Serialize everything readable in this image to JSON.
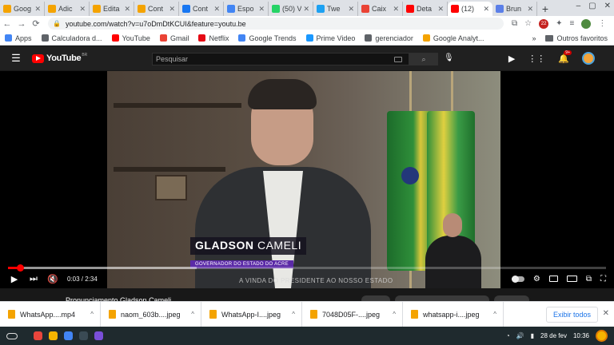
{
  "browser": {
    "tabs": [
      {
        "title": "Goog",
        "color": "#f4a300"
      },
      {
        "title": "Adic",
        "color": "#f4a300"
      },
      {
        "title": "Edita",
        "color": "#f4a300"
      },
      {
        "title": "Cont",
        "color": "#f4a300"
      },
      {
        "title": "Cont",
        "color": "#1877f2"
      },
      {
        "title": "Espo",
        "color": "#4285f4"
      },
      {
        "title": "(50) V",
        "color": "#25d366"
      },
      {
        "title": "Twe",
        "color": "#1da1f2"
      },
      {
        "title": "Caix",
        "color": "#ea4335"
      },
      {
        "title": "Deta",
        "color": "#ff0000"
      },
      {
        "title": "(12)",
        "color": "#ff0000",
        "active": true
      },
      {
        "title": "Brun",
        "color": "#5b7fe8"
      }
    ],
    "new_tab_label": "+",
    "window_controls": [
      "–",
      "▢",
      "✕"
    ],
    "address": "youtube.com/watch?v=u7oDmDtKCUI&feature=youtu.be",
    "ext_badge": "22",
    "bookmarks": [
      {
        "label": "Apps",
        "color": "#4285f4"
      },
      {
        "label": "Calculadora d...",
        "color": "#5f6368"
      },
      {
        "label": "YouTube",
        "color": "#ff0000"
      },
      {
        "label": "Gmail",
        "color": "#ea4335"
      },
      {
        "label": "Netflix",
        "color": "#e50914"
      },
      {
        "label": "Google Trends",
        "color": "#4285f4"
      },
      {
        "label": "Prime Video",
        "color": "#1a98ff"
      },
      {
        "label": "gerenciador",
        "color": "#5f6368"
      },
      {
        "label": "Google Analyt...",
        "color": "#f4a300"
      }
    ],
    "bookmarks_overflow": "»",
    "other_bookmarks": "Outros favoritos"
  },
  "youtube": {
    "logo_text": "YouTube",
    "logo_country": "BR",
    "search_placeholder": "Pesquisar",
    "notif_badge": "9+"
  },
  "player": {
    "lower_third_first": "GLADSON",
    "lower_third_last": "CAMELI",
    "lower_third_role": "GOVERNADOR DO ESTADO DO ACRE",
    "ticker": "A VINDA DO PRESIDENTE AO NOSSO ESTADO",
    "current_time": "0:03",
    "duration": "2:34",
    "time_display": "0:03 / 2:34",
    "played_fraction": 0.0195,
    "buffered_fraction": 0.316
  },
  "video_title": "Pronunciamento Gladson Cameli",
  "downloads": [
    {
      "name": "WhatsApp....mp4",
      "color": "#f4a300"
    },
    {
      "name": "naom_603b....jpeg",
      "color": "#f4a300"
    },
    {
      "name": "WhatsApp-I....jpeg",
      "color": "#f4a300"
    },
    {
      "name": "7048D05F-....jpeg",
      "color": "#f4a300"
    },
    {
      "name": "whatsapp-i....jpeg",
      "color": "#f4a300"
    }
  ],
  "show_all_label": "Exibir todos",
  "taskbar": {
    "apps": [
      "#e8453c",
      "#f4b400",
      "#4285f4",
      "#3a4a54",
      "#7a4fd8"
    ],
    "date": "28 de fev",
    "time": "10:36"
  }
}
